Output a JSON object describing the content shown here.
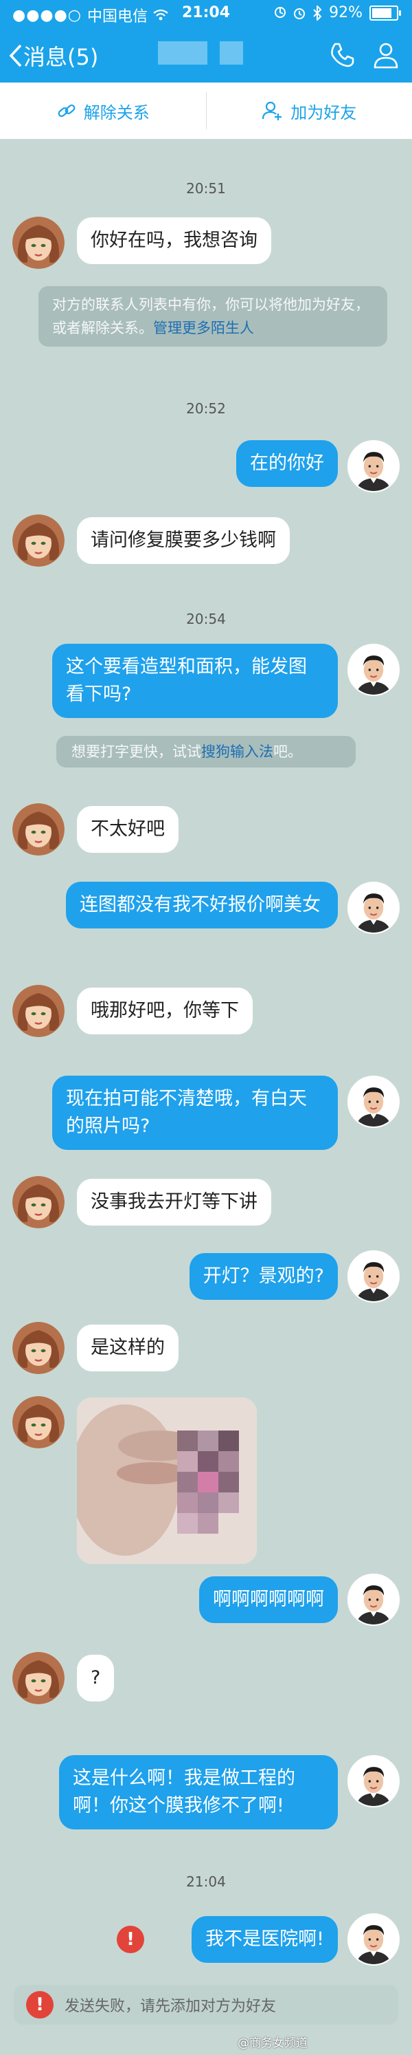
{
  "status_bar": {
    "signal_dots": "●●●●○",
    "carrier": "中国电信",
    "wifi_icon": "wifi-icon",
    "time": "21:04",
    "battery_percent": "92%",
    "battery_level": 0.92
  },
  "nav": {
    "back_label": "消息(5)",
    "back_icon": "chevron-left-icon",
    "phone_icon": "phone-icon",
    "profile_icon": "person-icon"
  },
  "actions": {
    "remove_label": "解除关系",
    "add_label": "加为好友"
  },
  "timestamps": [
    "20:51",
    "20:52",
    "20:54",
    "21:04"
  ],
  "notices": {
    "stranger": "对方的联系人列表中有你，你可以将他加为好友，或者解除关系。",
    "stranger_link": "管理更多陌生人",
    "input_prefix": "想要打字更快，试试",
    "input_link": "搜狗输入法",
    "input_suffix": "吧。"
  },
  "messages": [
    "你好在吗，我想咨询",
    "在的你好",
    "请问修复膜要多少钱啊",
    "这个要看造型和面积，能发图看下吗?",
    "不太好吧",
    "连图都没有我不好报价啊美女",
    "哦那好吧，你等下",
    "现在拍可能不清楚哦，有白天的照片吗?",
    "没事我去开灯等下讲",
    "开灯？景观的?",
    "是这样的",
    "啊啊啊啊啊啊",
    "?",
    "这是什么啊！我是做工程的啊！你这个膜我修不了啊!",
    "我不是医院啊!"
  ],
  "failure": {
    "icon": "!",
    "text": "发送失败，请先添加对方为好友"
  },
  "watermark": "@商务女频道",
  "colors": {
    "accent": "#1aa3ea",
    "outgoing_bubble": "#1fa1ec",
    "incoming_bubble": "#ffffff",
    "background": "#c7d8d4",
    "error": "#e2443a"
  }
}
